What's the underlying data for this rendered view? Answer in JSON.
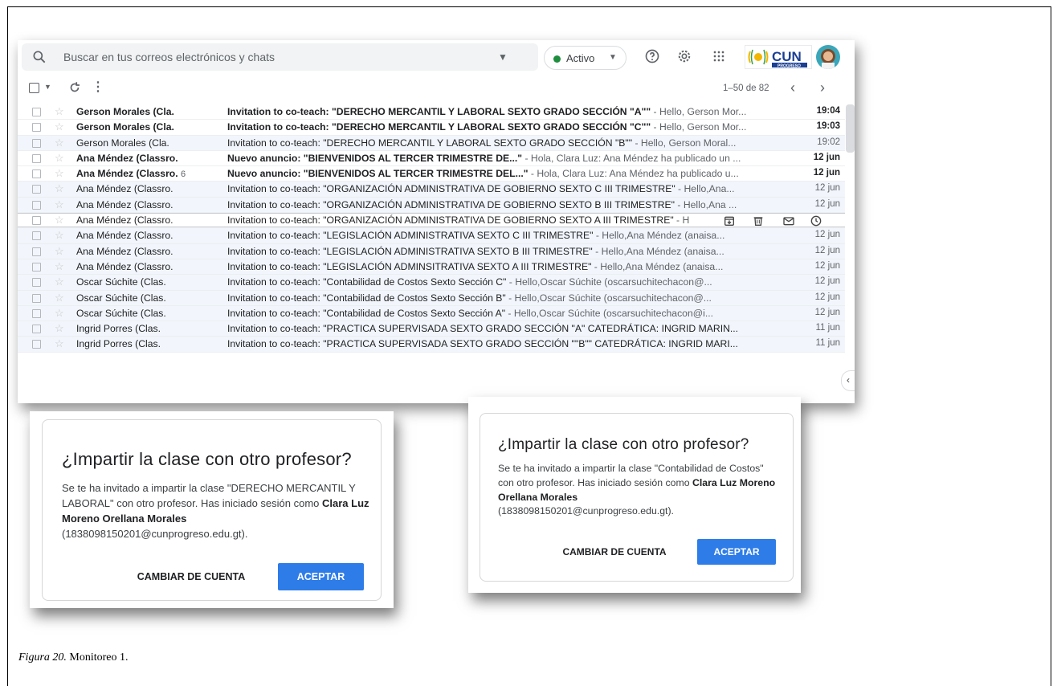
{
  "gmail": {
    "search_placeholder": "Buscar en tus correos electrónicos y chats",
    "status_label": "Activo",
    "brand_logo_text": "CUN",
    "brand_logo_sub": "PROGRESO",
    "pagination": "1–50 de 82",
    "rows": [
      {
        "sender": "Gerson Morales (Cla.",
        "subject": "Invitation to co-teach: \"DERECHO MERCANTIL Y LABORAL SEXTO GRADO SECCIÓN \"A\"\"",
        "snippet": " - Hello, Gerson Mor...",
        "date": "19:04",
        "unread": true
      },
      {
        "sender": "Gerson Morales (Cla.",
        "subject": "Invitation to co-teach: \"DERECHO MERCANTIL Y LABORAL SEXTO GRADO SECCIÓN \"C\"\"",
        "snippet": " - Hello, Gerson Mor...",
        "date": "19:03",
        "unread": true
      },
      {
        "sender": "Gerson Morales (Cla.",
        "subject": "Invitation to co-teach: \"DERECHO MERCANTIL Y LABORAL SEXTO GRADO SECCIÓN \"B\"\"",
        "snippet": " - Hello, Gerson Moral...",
        "date": "19:02",
        "unread": false
      },
      {
        "sender": "Ana Méndez (Classro.",
        "subject": "Nuevo anuncio: \"BIENVENIDOS AL TERCER TRIMESTRE DE...\"",
        "snippet": " - Hola, Clara Luz: Ana Méndez ha publicado un ...",
        "date": "12 jun",
        "unread": true
      },
      {
        "sender": "Ana Méndez (Classro.",
        "count": "6",
        "subject": "Nuevo anuncio: \"BIENVENIDOS AL TERCER TRIMESTRE DEL...\"",
        "snippet": " - Hola, Clara Luz: Ana Méndez ha publicado u...",
        "date": "12 jun",
        "unread": true
      },
      {
        "sender": "Ana Méndez (Classro.",
        "subject": "Invitation to co-teach: \"ORGANIZACIÓN ADMINISTRATIVA DE GOBIERNO SEXTO C III TRIMESTRE\"",
        "snippet": " - Hello,Ana...",
        "date": "12 jun",
        "unread": false
      },
      {
        "sender": "Ana Méndez (Classro.",
        "subject": "Invitation to co-teach: \"ORGANIZACIÓN ADMINISTRATIVA DE GOBIERNO SEXTO B III TRIMESTRE\"",
        "snippet": " - Hello,Ana ...",
        "date": "12 jun",
        "unread": false
      },
      {
        "sender": "Ana Méndez (Classro.",
        "subject": "Invitation to co-teach: \"ORGANIZACIÓN ADMINISTRATIVA DE GOBIERNO SEXTO A III TRIMESTRE\"",
        "snippet": " - H",
        "date": "",
        "unread": false,
        "hover": true
      },
      {
        "sender": "Ana Méndez (Classro.",
        "subject": "Invitation to co-teach: \"LEGISLACIÓN ADMINISTRATIVA SEXTO C III TRIMESTRE\"",
        "snippet": " - Hello,Ana Méndez (anaisa...",
        "date": "12 jun",
        "unread": false
      },
      {
        "sender": "Ana Méndez (Classro.",
        "subject": "Invitation to co-teach: \"LEGISLACIÓN ADMINISTRATIVA SEXTO B III TRIMESTRE\"",
        "snippet": " - Hello,Ana Méndez (anaisa...",
        "date": "12 jun",
        "unread": false
      },
      {
        "sender": "Ana Méndez (Classro.",
        "subject": "Invitation to co-teach: \"LEGISLACIÓN ADMINSITRATIVA SEXTO A III TRIMESTRE\"",
        "snippet": " - Hello,Ana Méndez (anaisa...",
        "date": "12 jun",
        "unread": false
      },
      {
        "sender": "Oscar Súchite (Clas.",
        "subject": "Invitation to co-teach: \"Contabilidad de Costos Sexto Sección C\"",
        "snippet": " - Hello,Oscar Súchite (oscarsuchitechacon@...",
        "date": "12 jun",
        "unread": false
      },
      {
        "sender": "Oscar Súchite (Clas.",
        "subject": "Invitation to co-teach: \"Contabilidad de Costos Sexto Sección B\"",
        "snippet": " - Hello,Oscar Súchite (oscarsuchitechacon@...",
        "date": "12 jun",
        "unread": false
      },
      {
        "sender": "Oscar Súchite (Clas.",
        "subject": "Invitation to co-teach: \"Contabilidad de Costos Sexto Sección A\"",
        "snippet": " - Hello,Oscar Súchite (oscarsuchitechacon@i...",
        "date": "12 jun",
        "unread": false
      },
      {
        "sender": "Ingrid Porres (Clas.",
        "subject": "Invitation to co-teach: \"PRACTICA SUPERVISADA SEXTO GRADO SECCIÓN \"A\" CATEDRÁTICA: INGRID MARIN...",
        "snippet": "",
        "date": "11 jun",
        "unread": false
      },
      {
        "sender": "Ingrid Porres (Clas.",
        "subject": "Invitation to co-teach: \"PRACTICA SUPERVISADA SEXTO GRADO SECCIÓN \"\"B\"\" CATEDRÁTICA: INGRID MARI...",
        "snippet": "",
        "date": "11 jun",
        "unread": false
      }
    ]
  },
  "dialog_left": {
    "title": "¿Impartir la clase con otro profesor?",
    "body_prefix": "Se te ha invitado a impartir la clase \"DERECHO MERCANTIL Y LABORAL\" con otro profesor. Has iniciado sesión como ",
    "user_name": "Clara Luz Moreno Orellana Morales",
    "user_email": "(1838098150201@cunprogreso.edu.gt)",
    "body_suffix": ".",
    "cancel_label": "CAMBIAR DE CUENTA",
    "ok_label": "ACEPTAR"
  },
  "dialog_right": {
    "title": "¿Impartir la clase con otro profesor?",
    "body_prefix": "Se te ha invitado a impartir la clase \"Contabilidad de Costos\" con otro profesor. Has iniciado sesión como ",
    "user_name": "Clara Luz Moreno Orellana Morales",
    "user_email": "(1838098150201@cunprogreso.edu.gt)",
    "body_suffix": ".",
    "cancel_label": "CAMBIAR DE CUENTA",
    "ok_label": "ACEPTAR"
  },
  "caption": {
    "label": "Figura 20.",
    "text": " Monitoreo 1."
  },
  "colors": {
    "accent": "#2e7ce8",
    "status_green": "#1e8e3e",
    "read_row_bg": "#f2f6fc"
  }
}
